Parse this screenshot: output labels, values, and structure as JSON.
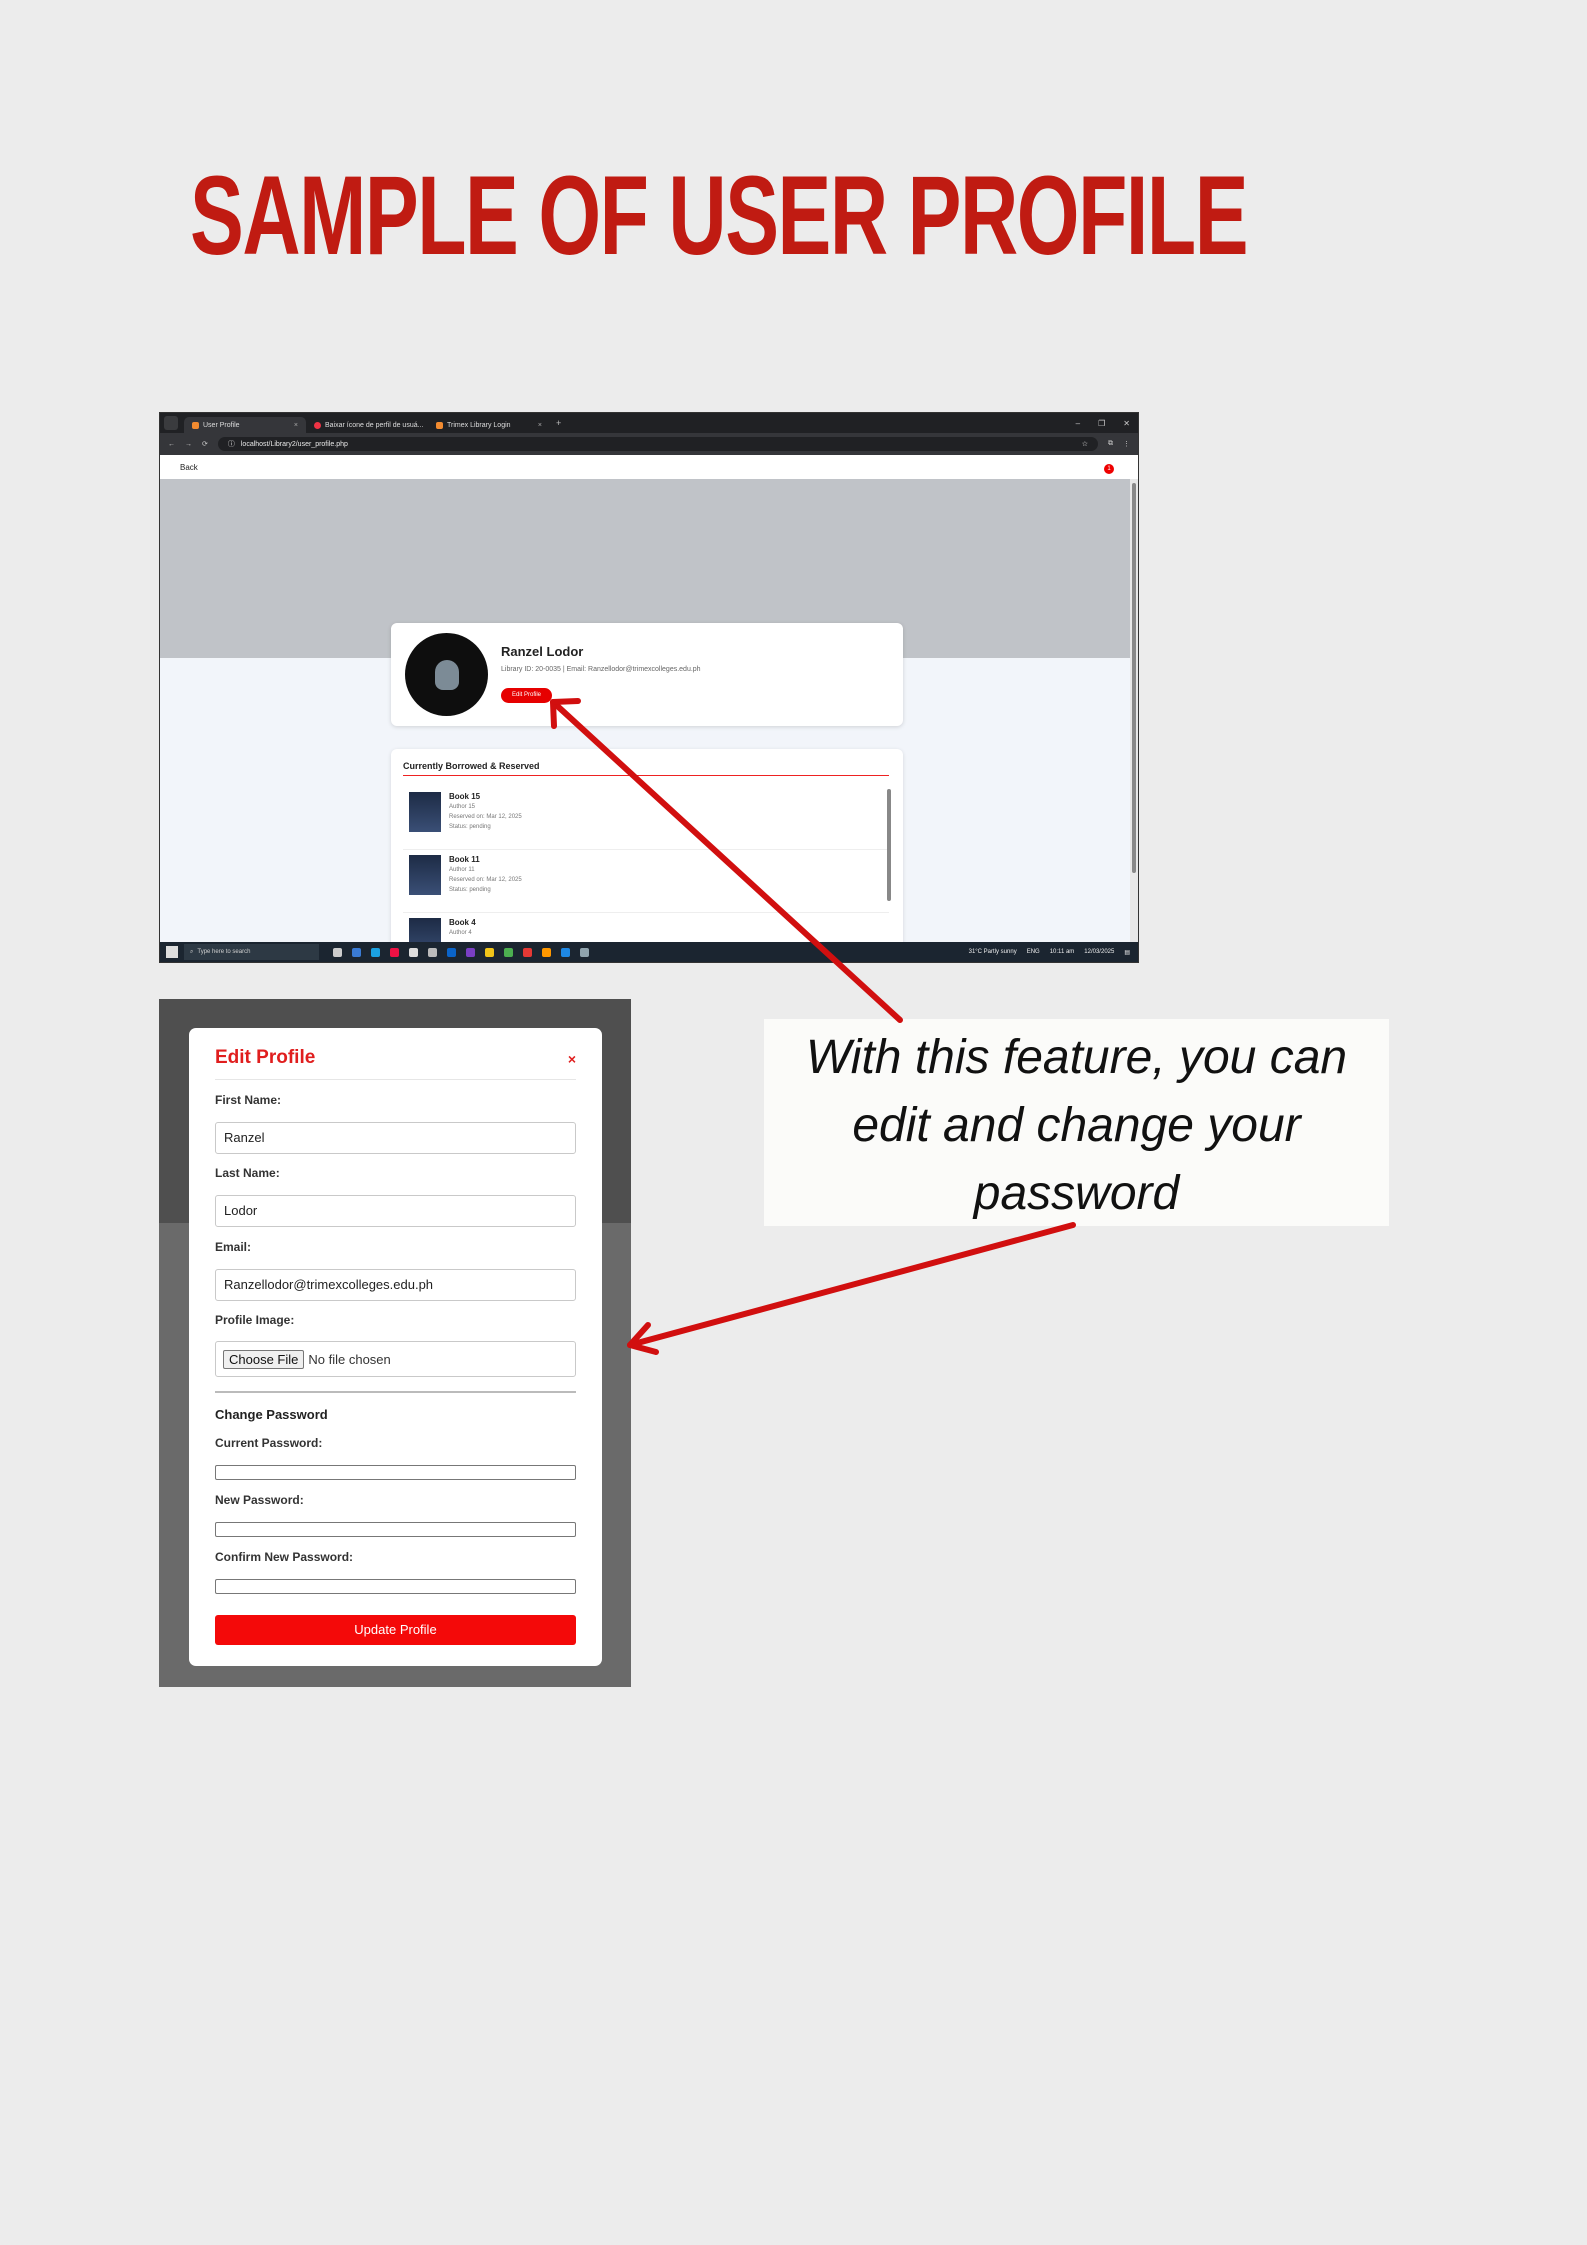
{
  "title": "SAMPLE OF USER PROFILE",
  "caption": "With this feature, you can edit and change your password",
  "browser": {
    "tabs": [
      {
        "label": "User Profile"
      },
      {
        "label": "Baixar ícone de perfil de usuá..."
      },
      {
        "label": "Trimex Library Login"
      }
    ],
    "url": "localhost/Library2/user_profile.php",
    "back_label": "Back",
    "notification_count": "1"
  },
  "profile": {
    "name": "Ranzel Lodor",
    "meta": "Library ID: 20-0035 | Email: Ranzellodor@trimexcolleges.edu.ph",
    "edit_button": "Edit Profile"
  },
  "borrowed": {
    "heading": "Currently Borrowed & Reserved",
    "items": [
      {
        "title": "Book 15",
        "author": "Author 15",
        "reserved": "Reserved on: Mar 12, 2025",
        "status": "Status: pending"
      },
      {
        "title": "Book 11",
        "author": "Author 11",
        "reserved": "Reserved on: Mar 12, 2025",
        "status": "Status: pending"
      },
      {
        "title": "Book 4",
        "author": "Author 4",
        "reserved": "",
        "status": ""
      }
    ]
  },
  "taskbar": {
    "search_placeholder": "Type here to search",
    "weather": "31°C  Partly sunny",
    "lang": "ENG",
    "time": "10:11 am",
    "date": "12/03/2025"
  },
  "modal": {
    "title": "Edit Profile",
    "close": "×",
    "first_name_label": "First Name:",
    "first_name_value": "Ranzel",
    "last_name_label": "Last Name:",
    "last_name_value": "Lodor",
    "email_label": "Email:",
    "email_value": "Ranzellodor@trimexcolleges.edu.ph",
    "image_label": "Profile Image:",
    "choose_file": "Choose File",
    "no_file": "No file chosen",
    "change_password": "Change Password",
    "current_password_label": "Current Password:",
    "new_password_label": "New Password:",
    "confirm_password_label": "Confirm New Password:",
    "update_button": "Update Profile"
  },
  "colors": {
    "title_red": "#c01b12",
    "accent_red": "#e60000",
    "arrow_red": "#d10f0f"
  }
}
